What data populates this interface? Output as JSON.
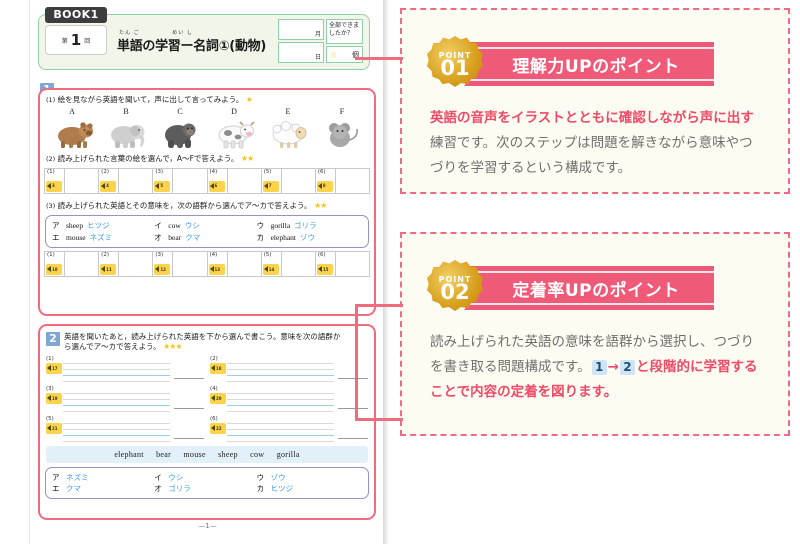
{
  "worksheet": {
    "book_badge": "BOOK1",
    "kai_prefix": "第",
    "kai_number": "1",
    "kai_suffix": "回",
    "title_ruby_1": "たん ご",
    "title_ruby_2": "めい し",
    "title": "単語の学習ー名詞①(動物)",
    "date_month_label": "月",
    "date_day_label": "日",
    "check_question": "全部できましたか？",
    "star_glyph": "☆",
    "star_unit": "個",
    "page_footer": "—1—"
  },
  "section1": {
    "number": "1",
    "q1": {
      "num": "(1)",
      "text": "絵を見ながら英語を聞いて，声に出して言ってみよう。",
      "ruby": "えい ご",
      "stars": "★",
      "animals": [
        {
          "letter": "A",
          "name": "bear-illustration"
        },
        {
          "letter": "B",
          "name": "elephant-illustration"
        },
        {
          "letter": "C",
          "name": "gorilla-illustration"
        },
        {
          "letter": "D",
          "name": "cow-illustration"
        },
        {
          "letter": "E",
          "name": "sheep-illustration"
        },
        {
          "letter": "F",
          "name": "mouse-illustration"
        }
      ]
    },
    "q2": {
      "num": "(2)",
      "text": "読み上げられた言葉の絵を選んで，A〜Fで答えよう。",
      "stars": "★★",
      "answers": [
        {
          "label": "(1)",
          "track": "3"
        },
        {
          "label": "(2)",
          "track": "4"
        },
        {
          "label": "(3)",
          "track": "5"
        },
        {
          "label": "(4)",
          "track": "6"
        },
        {
          "label": "(5)",
          "track": "7"
        },
        {
          "label": "(6)",
          "track": "8"
        }
      ]
    },
    "q3": {
      "num": "(3)",
      "text": "読み上げられた英語とその意味を，次の語群から選んでア〜カで答えよう。",
      "stars": "★★",
      "word_bank": [
        {
          "mark": "ア",
          "en": "sheep",
          "jp": "ヒツジ"
        },
        {
          "mark": "イ",
          "en": "cow",
          "jp": "ウシ"
        },
        {
          "mark": "ウ",
          "en": "gorilla",
          "jp": "ゴリラ"
        },
        {
          "mark": "エ",
          "en": "mouse",
          "jp": "ネズミ"
        },
        {
          "mark": "オ",
          "en": "bear",
          "jp": "クマ"
        },
        {
          "mark": "カ",
          "en": "elephant",
          "jp": "ゾウ"
        }
      ],
      "answers": [
        {
          "label": "(1)",
          "track": "10"
        },
        {
          "label": "(2)",
          "track": "11"
        },
        {
          "label": "(3)",
          "track": "12"
        },
        {
          "label": "(4)",
          "track": "13"
        },
        {
          "label": "(5)",
          "track": "14"
        },
        {
          "label": "(6)",
          "track": "15"
        }
      ]
    }
  },
  "section2": {
    "number": "2",
    "text_line1": "英語を聞いたあと，読み上げられた英語を下から選んで書こう。意味を次の語群か",
    "text_line2": "ら選んでア〜カで答えよう。",
    "stars": "★★★",
    "write_rows": [
      {
        "label": "(1)",
        "track": "17"
      },
      {
        "label": "(2)",
        "track": "18"
      },
      {
        "label": "(3)",
        "track": "19"
      },
      {
        "label": "(4)",
        "track": "20"
      },
      {
        "label": "(5)",
        "track": "21"
      },
      {
        "label": "(6)",
        "track": "22"
      }
    ],
    "en_bank": [
      "elephant",
      "bear",
      "mouse",
      "sheep",
      "cow",
      "gorilla"
    ],
    "jp_bank": [
      {
        "mark": "ア",
        "jp": "ネズミ"
      },
      {
        "mark": "イ",
        "jp": "ウシ"
      },
      {
        "mark": "ウ",
        "jp": "ゾウ"
      },
      {
        "mark": "エ",
        "jp": "クマ"
      },
      {
        "mark": "オ",
        "jp": "ゴリラ"
      },
      {
        "mark": "カ",
        "jp": "ヒツジ"
      }
    ]
  },
  "points": [
    {
      "badge_label": "POINT",
      "badge_number": "01",
      "ribbon_title": "理解力UPのポイント",
      "body_hl_1": "英語の音声をイラストとともに確認しながら声に出す",
      "body_rest_1": "練習です。次のステップは問題を解きながら意味やつづりを学習するという構成です。"
    },
    {
      "badge_label": "POINT",
      "badge_number": "02",
      "ribbon_title": "定着率UPのポイント",
      "body_pre": "読み上げられた英語の意味を語群から選択し、つづりを書き取る問題構成です。",
      "mini_1": "1",
      "arrow": "→",
      "mini_2": "2",
      "body_hl_2": "と段階的に学習することで内容の定着を図ります。"
    }
  ],
  "colors": {
    "frame_pink": "#ef6b7e",
    "ribbon_pink": "#ef5a78",
    "badge_gold": "#d79f1c",
    "word_bank_purple": "#9b8ec9",
    "katakana_blue": "#3c9ae8",
    "section_blue": "#7ea7d6",
    "speaker_yellow": "#fcd34a",
    "header_green": "#8fd0a8"
  }
}
